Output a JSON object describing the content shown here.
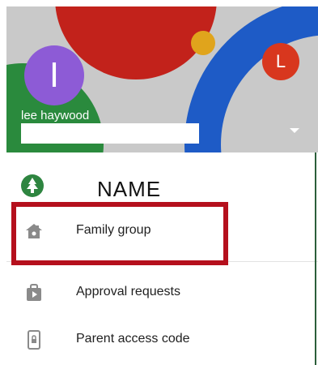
{
  "header": {
    "avatar_initial": "I",
    "secondary_avatar_initial": "L",
    "user_name": "lee haywood",
    "colors": {
      "avatar": "#8d5bd6",
      "secondary_avatar": "#d8371e",
      "red": "#c2221b",
      "green": "#2a8a3d",
      "blue": "#1e5bc6",
      "yellow": "#e0a41c"
    }
  },
  "account": {
    "annotation": "NAME",
    "icon": "account-tree-icon"
  },
  "menu": {
    "items": [
      {
        "label": "Family group",
        "icon": "home-icon"
      },
      {
        "label": "Approval requests",
        "icon": "play-store-bag-icon"
      },
      {
        "label": "Parent access code",
        "icon": "phone-lock-icon"
      }
    ]
  },
  "highlight_color": "#b5101d"
}
